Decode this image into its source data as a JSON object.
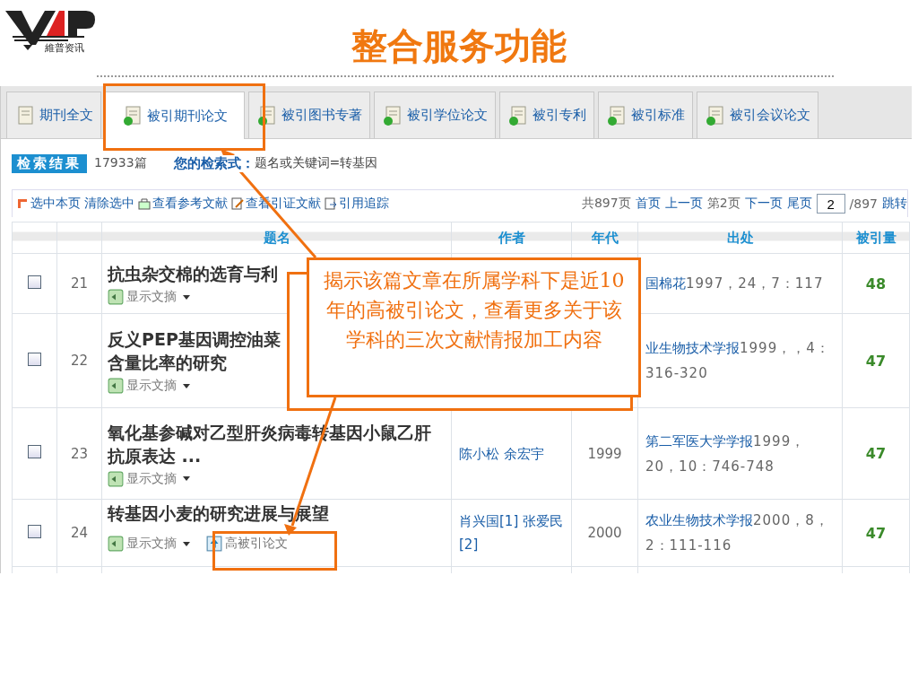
{
  "slide": {
    "logo_caption": "維普资讯",
    "title": "整合服务功能"
  },
  "tabs": [
    {
      "label": "期刊全文",
      "kind": "fulltext",
      "selected": false
    },
    {
      "label": "被引期刊论文",
      "kind": "cited",
      "selected": true
    },
    {
      "label": "被引图书专著",
      "kind": "cited",
      "selected": false
    },
    {
      "label": "被引学位论文",
      "kind": "cited",
      "selected": false
    },
    {
      "label": "被引专利",
      "kind": "cited",
      "selected": false
    },
    {
      "label": "被引标准",
      "kind": "cited",
      "selected": false
    },
    {
      "label": "被引会议论文",
      "kind": "cited",
      "selected": false
    }
  ],
  "results": {
    "badge": "检索结果",
    "count": "17933篇",
    "query_label": "您的检索式：",
    "query": "题名或关键词=转基因"
  },
  "toolbar": {
    "actions": [
      {
        "label": "选中本页",
        "kind": "select"
      },
      {
        "label": "清除选中",
        "kind": "plain"
      },
      {
        "label": "查看参考文献",
        "kind": "refs"
      },
      {
        "label": "查看引证文献",
        "kind": "cites"
      },
      {
        "label": "引用追踪",
        "kind": "trace"
      }
    ],
    "pager": {
      "total": "共897页",
      "first": "首页",
      "prev": "上一页",
      "current": "第2页",
      "next": "下一页",
      "last": "尾页",
      "page_input": "2",
      "page_count": "/897",
      "go": "跳转"
    }
  },
  "table": {
    "columns": [
      "题名",
      "作者",
      "年代",
      "出处",
      "被引量"
    ],
    "rows": [
      {
        "checked": false,
        "number": "21",
        "title": "抗虫杂交棉的选育与利",
        "abstract_toggle": "显示文摘",
        "journal": "国棉花",
        "detail": "1997，24，7：117",
        "cited": "48"
      },
      {
        "checked": false,
        "number": "22",
        "title": "反义PEP基因调控油菜",
        "title_2": "含量比率的研究",
        "abstract_toggle": "显示文摘",
        "journal": "业生物技术学报",
        "detail": "1999，，4：316-320",
        "cited": "47"
      },
      {
        "checked": false,
        "number": "23",
        "title": "氧化基参碱对乙型肝炎病毒转基因小鼠乙肝抗原表达 ...",
        "abstract_toggle": "显示文摘",
        "author": "陈小松 余宏宇",
        "year": "1999",
        "journal": "第二军医大学学报",
        "detail": "1999，20，10：746-748",
        "cited": "47"
      },
      {
        "checked": false,
        "number": "24",
        "title": "转基因小麦的研究进展与展望",
        "abstract_toggle": "显示文摘",
        "high_cited": "高被引论文",
        "author": "肖兴国[1] 张爱民[2]",
        "year": "2000",
        "journal": "农业生物技术学报",
        "detail": "2000，8，2：111-116",
        "cited": "47"
      }
    ]
  },
  "callout": {
    "text": "揭示该篇文章在所属学科下是近10年的高被引论文，查看更多关于该学科的三次文献情报加工内容"
  }
}
